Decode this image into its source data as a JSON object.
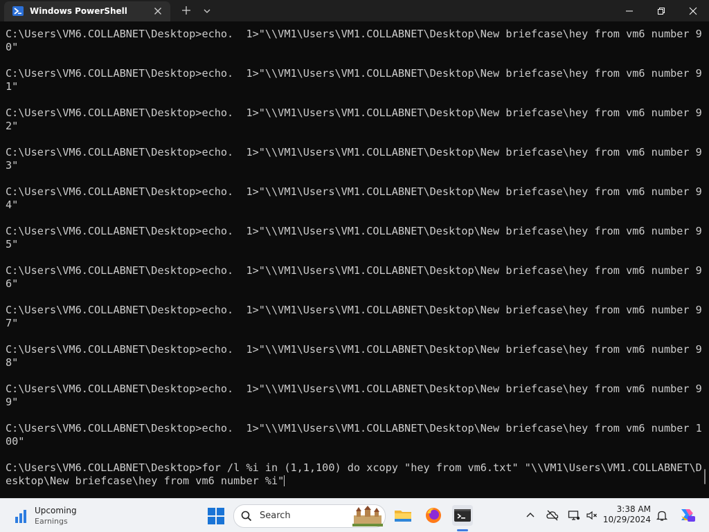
{
  "window": {
    "tab_title": "Windows PowerShell",
    "icons": {
      "tab": "powershell-icon",
      "close_tab": "close-icon",
      "new_tab": "plus-icon",
      "dropdown": "chevron-down-icon",
      "minimize": "minimize-icon",
      "restore": "restore-icon",
      "close": "close-icon"
    }
  },
  "terminal": {
    "lines": [
      "C:\\Users\\VM6.COLLABNET\\Desktop>echo.  1>\"\\\\VM1\\Users\\VM1.COLLABNET\\Desktop\\New briefcase\\hey from vm6 number 9",
      "0\"",
      "",
      "C:\\Users\\VM6.COLLABNET\\Desktop>echo.  1>\"\\\\VM1\\Users\\VM1.COLLABNET\\Desktop\\New briefcase\\hey from vm6 number 9",
      "1\"",
      "",
      "C:\\Users\\VM6.COLLABNET\\Desktop>echo.  1>\"\\\\VM1\\Users\\VM1.COLLABNET\\Desktop\\New briefcase\\hey from vm6 number 9",
      "2\"",
      "",
      "C:\\Users\\VM6.COLLABNET\\Desktop>echo.  1>\"\\\\VM1\\Users\\VM1.COLLABNET\\Desktop\\New briefcase\\hey from vm6 number 9",
      "3\"",
      "",
      "C:\\Users\\VM6.COLLABNET\\Desktop>echo.  1>\"\\\\VM1\\Users\\VM1.COLLABNET\\Desktop\\New briefcase\\hey from vm6 number 9",
      "4\"",
      "",
      "C:\\Users\\VM6.COLLABNET\\Desktop>echo.  1>\"\\\\VM1\\Users\\VM1.COLLABNET\\Desktop\\New briefcase\\hey from vm6 number 9",
      "5\"",
      "",
      "C:\\Users\\VM6.COLLABNET\\Desktop>echo.  1>\"\\\\VM1\\Users\\VM1.COLLABNET\\Desktop\\New briefcase\\hey from vm6 number 9",
      "6\"",
      "",
      "C:\\Users\\VM6.COLLABNET\\Desktop>echo.  1>\"\\\\VM1\\Users\\VM1.COLLABNET\\Desktop\\New briefcase\\hey from vm6 number 9",
      "7\"",
      "",
      "C:\\Users\\VM6.COLLABNET\\Desktop>echo.  1>\"\\\\VM1\\Users\\VM1.COLLABNET\\Desktop\\New briefcase\\hey from vm6 number 9",
      "8\"",
      "",
      "C:\\Users\\VM6.COLLABNET\\Desktop>echo.  1>\"\\\\VM1\\Users\\VM1.COLLABNET\\Desktop\\New briefcase\\hey from vm6 number 9",
      "9\"",
      "",
      "C:\\Users\\VM6.COLLABNET\\Desktop>echo.  1>\"\\\\VM1\\Users\\VM1.COLLABNET\\Desktop\\New briefcase\\hey from vm6 number 1",
      "00\"",
      "",
      "C:\\Users\\VM6.COLLABNET\\Desktop>for /l %i in (1,1,100) do xcopy \"hey from vm6.txt\" \"\\\\VM1\\Users\\VM1.COLLABNET\\D",
      "esktop\\New briefcase\\hey from vm6 number %i\""
    ],
    "text_color": "#cccccc",
    "background": "#0c0c0c"
  },
  "taskbar": {
    "weather": {
      "title": "Upcoming",
      "subtitle": "Earnings",
      "icon": "stock-chart-icon"
    },
    "search": {
      "label": "Search",
      "icon": "search-icon"
    },
    "apps": [
      {
        "name": "start",
        "icon": "windows-logo-icon"
      },
      {
        "name": "file-explorer",
        "icon": "folder-icon"
      },
      {
        "name": "firefox",
        "icon": "firefox-icon"
      },
      {
        "name": "terminal",
        "icon": "terminal-icon",
        "active": true
      }
    ],
    "tray": {
      "icons": [
        "chevron-up-icon",
        "cloud-offline-icon",
        "display-icon",
        "speaker-muted-icon"
      ]
    },
    "clock": {
      "time": "3:38 AM",
      "date": "10/29/2024"
    },
    "notification_icon": "bell-icon",
    "copilot_icon": "copilot-icon",
    "accent": "#3d7be0"
  }
}
